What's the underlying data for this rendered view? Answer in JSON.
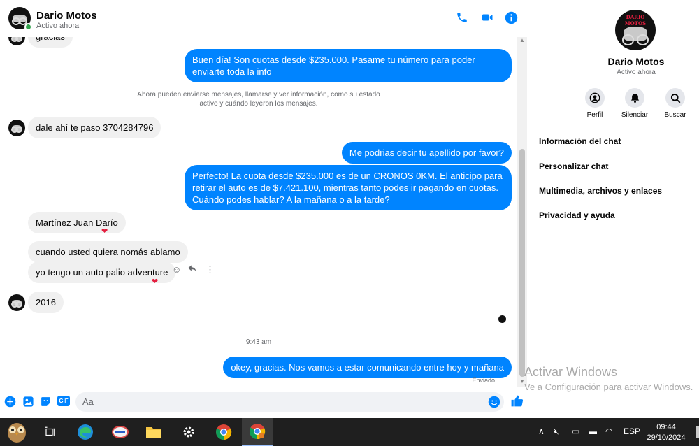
{
  "contact": {
    "name": "Dario Motos",
    "status": "Activo ahora",
    "avatar_brand": "DARIO MOTOS"
  },
  "messages": {
    "partial_top": "gracias",
    "m1": "Buen día! Son cuotas desde $235.000. Pasame tu número para poder enviarte toda la info",
    "system_line1": "Ahora pueden enviarse mensajes, llamarse y ver información, como su estado",
    "system_line2": "activo y cuándo leyeron los mensajes.",
    "m2": "dale ahí te paso 3704284796",
    "m3": "Me podrias decir tu apellido por favor?",
    "m4": "Perfecto! La cuota desde $235.000 es de un CRONOS 0KM. El anticipo para retirar el auto es de $7.421.100, mientras tanto podes ir pagando en cuotas. Cuándo podes hablar? A la mañana o a la tarde?",
    "m5": "Martínez Juan Darío",
    "m6": "cuando usted quiera nomás ablamo",
    "m7": "yo tengo un auto palio adventure",
    "m8": "2016",
    "time": "9:43 am",
    "m9": "okey, gracias. Nos vamos a estar comunicando entre hoy y mañana",
    "sent_status": "Enviado"
  },
  "composer": {
    "placeholder": "Aa",
    "gif_label": "GIF"
  },
  "sidebar": {
    "actions": [
      {
        "label": "Perfil",
        "icon": "profile-icon"
      },
      {
        "label": "Silenciar",
        "icon": "bell-icon"
      },
      {
        "label": "Buscar",
        "icon": "search-icon"
      }
    ],
    "menu": [
      "Información del chat",
      "Personalizar chat",
      "Multimedia, archivos y enlaces",
      "Privacidad y ayuda"
    ]
  },
  "watermark": {
    "line1": "Activar Windows",
    "line2": "Ve a Configuración para activar Windows."
  },
  "taskbar": {
    "language": "ESP",
    "time": "09:44",
    "date": "29/10/2024"
  },
  "colors": {
    "accent": "#0084ff",
    "incoming_bubble": "#f0f0f0",
    "heart": "#e41e3f",
    "online": "#31a24c"
  }
}
